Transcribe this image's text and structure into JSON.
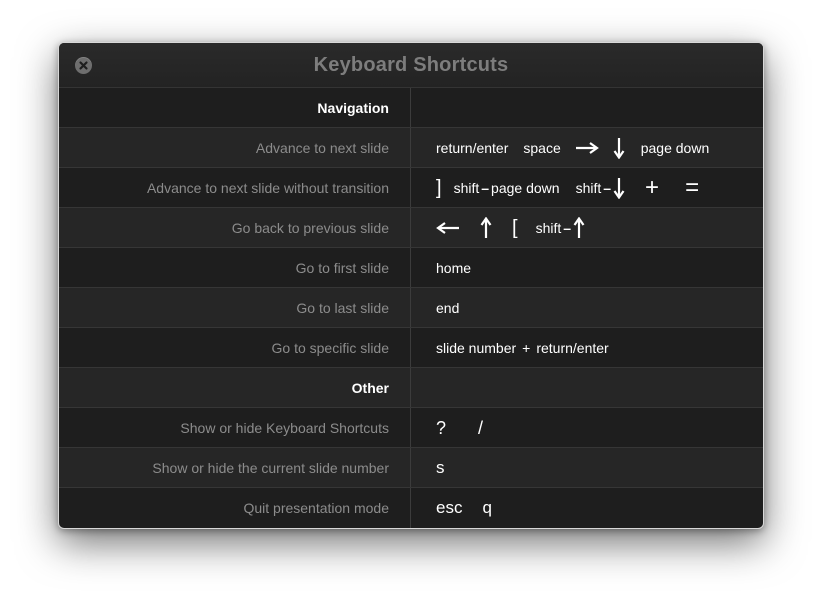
{
  "dialog": {
    "title": "Keyboard Shortcuts",
    "close_icon": "close-circle-icon"
  },
  "sections": {
    "navigation": "Navigation",
    "other": "Other"
  },
  "rows": {
    "next_slide": {
      "label": "Advance to next slide",
      "k1": "return/enter",
      "k2": "space",
      "k5": "page down"
    },
    "next_no_transition": {
      "label": "Advance to next slide without transition",
      "k1": "]",
      "k2_mod": "shift",
      "k2_key": "page down",
      "k3_mod": "shift",
      "k4": "+",
      "k5": "="
    },
    "prev_slide": {
      "label": "Go back to previous slide",
      "k3": "[",
      "k4_mod": "shift"
    },
    "first_slide": {
      "label": "Go to first slide",
      "k1": "home"
    },
    "last_slide": {
      "label": "Go to last slide",
      "k1": "end"
    },
    "specific_slide": {
      "label": "Go to specific slide",
      "k1": "slide number",
      "plus": "+",
      "k2": "return/enter"
    },
    "toggle_shortcuts": {
      "label": "Show or hide Keyboard Shortcuts",
      "k1": "?",
      "k2": "/"
    },
    "toggle_slide_number": {
      "label": "Show or hide the current slide number",
      "k1": "s"
    },
    "quit": {
      "label": "Quit presentation mode",
      "k1": "esc",
      "k2": "q"
    }
  },
  "colors": {
    "background": "#1e1e1e",
    "row_alt": "#262626",
    "label_text": "#8c8c8c",
    "key_text": "#ffffff",
    "title_text": "#7d7d7d"
  }
}
